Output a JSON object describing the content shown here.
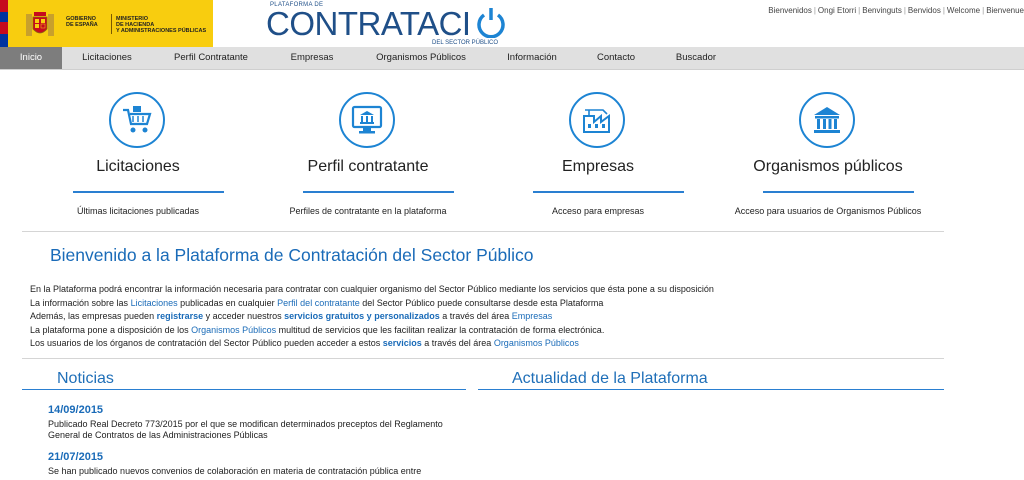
{
  "header": {
    "gobierno": "GOBIERNO\nDE ESPAÑA",
    "ministerio": "MINISTERIO\nDE HACIENDA\nY ADMINISTRACIONES PÚBLICAS",
    "logo_top": "PLATAFORMA DE",
    "logo_main": "CONTRATACI",
    "logo_sub": "DEL SECTOR PÚBLICO",
    "languages": [
      "Bienvenidos",
      "Ongi Etorri",
      "Benvinguts",
      "Benvidos",
      "Welcome",
      "Bienvenue"
    ]
  },
  "nav": {
    "items": [
      {
        "label": "Inicio"
      },
      {
        "label": "Licitaciones"
      },
      {
        "label": "Perfil Contratante"
      },
      {
        "label": "Empresas"
      },
      {
        "label": "Organismos Públicos"
      },
      {
        "label": "Información"
      },
      {
        "label": "Contacto"
      },
      {
        "label": "Buscador"
      }
    ],
    "active_index": 0
  },
  "cards": [
    {
      "title": "Licitaciones",
      "desc": "Últimas licitaciones publicadas",
      "icon": "shopping-cart-icon"
    },
    {
      "title": "Perfil contratante",
      "desc": "Perfiles de contratante en la plataforma",
      "icon": "monitor-building-icon"
    },
    {
      "title": "Empresas",
      "desc": "Acceso para empresas",
      "icon": "factory-icon"
    },
    {
      "title": "Organismos públicos",
      "desc": "Acceso para usuarios de Organismos Públicos",
      "icon": "public-building-icon"
    }
  ],
  "welcome": {
    "title": "Bienvenido a la Plataforma de Contratación del Sector Público",
    "l1": "En la Plataforma podrá encontrar la información necesaria para contratar con cualquier organismo del Sector Público mediante los servicios que ésta pone a su disposición",
    "l2a": "La información sobre las ",
    "l2b": "Licitaciones",
    "l2c": " publicadas en cualquier ",
    "l2d": "Perfil del contratante",
    "l2e": " del Sector Público puede consultarse desde esta Plataforma",
    "l3a": "Además, las empresas pueden ",
    "l3b": "registrarse",
    "l3c": " y acceder nuestros ",
    "l3d": "servicios gratuitos y personalizados",
    "l3e": " a través del área ",
    "l3f": "Empresas",
    "l4a": "La plataforma pone a disposición de los ",
    "l4b": "Organismos Públicos",
    "l4c": " multitud de servicios que les facilitan realizar la contratación de forma electrónica.",
    "l5a": "Los usuarios de los órganos de contratación del Sector Público pueden acceder a estos ",
    "l5b": "servicios",
    "l5c": " a través del área ",
    "l5d": "Organismos Públicos"
  },
  "news": {
    "title": "Noticias",
    "items": [
      {
        "date": "14/09/2015",
        "text": "Publicado Real Decreto 773/2015 por el que se modifican determinados preceptos del Reglamento General de Contratos de las Administraciones Públicas"
      },
      {
        "date": "21/07/2015",
        "text": "Se han publicado nuevos convenios de colaboración en materia de contratación pública entre"
      }
    ]
  },
  "actualidad": {
    "title": "Actualidad de la Plataforma"
  },
  "colors": {
    "accent": "#1a6bb8",
    "gov_yellow": "#f8cd0f",
    "nav_bg": "#e0e0e0",
    "nav_active": "#7d7d7d"
  }
}
